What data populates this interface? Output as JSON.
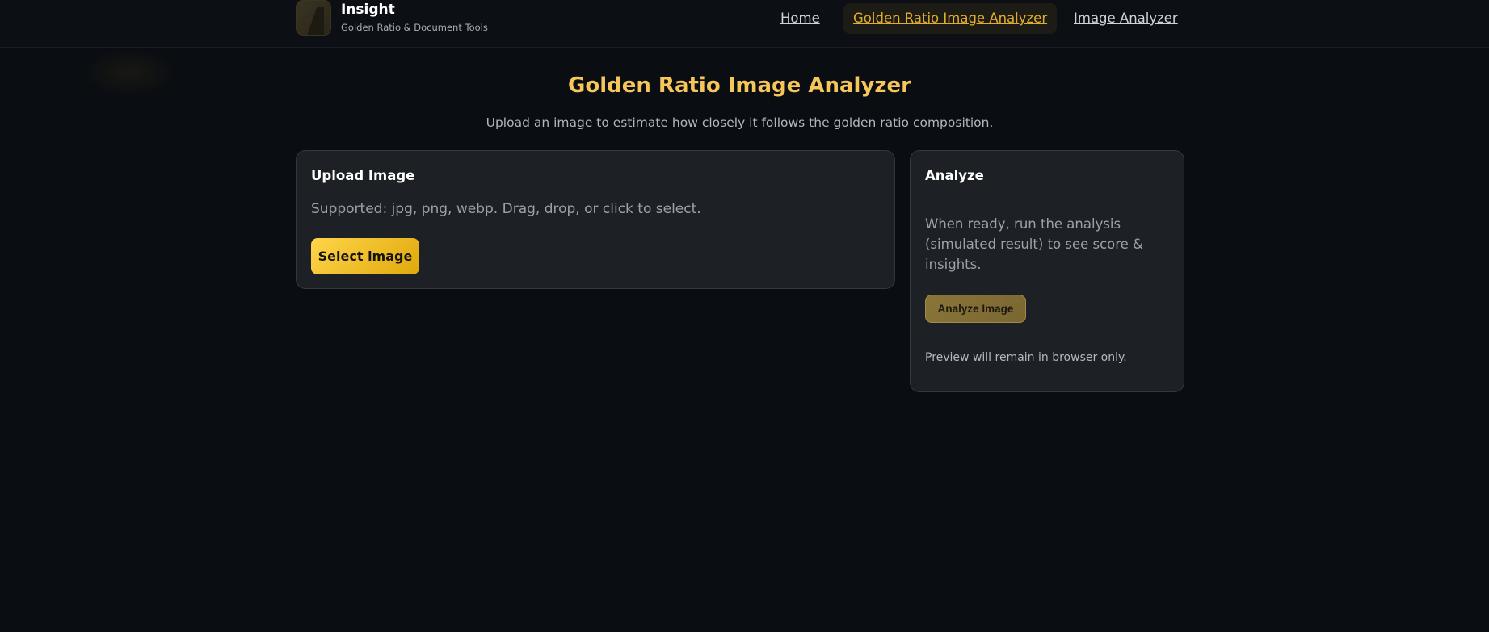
{
  "brand": {
    "title": "Insight",
    "subtitle": "Golden Ratio & Document Tools",
    "logo_icon": "golden-spiral-logo"
  },
  "nav": {
    "items": [
      {
        "label": "Home",
        "active": false
      },
      {
        "label": "Golden Ratio Image Analyzer",
        "active": true
      },
      {
        "label": "Image Analyzer",
        "active": false
      }
    ]
  },
  "page": {
    "title": "Golden Ratio Image Analyzer",
    "description": "Upload an image to estimate how closely it follows the golden ratio composition."
  },
  "upload_card": {
    "title": "Upload Image",
    "description": "Supported: jpg, png, webp. Drag, drop, or click to select.",
    "button_label": "Select image"
  },
  "analyze_card": {
    "title": "Analyze",
    "description": "When ready, run the analysis (simulated result) to see score & insights.",
    "button_label": "Analyze Image",
    "note": "Preview will remain in browser only."
  },
  "colors": {
    "accent": "#f6c65b",
    "button_gold": "#ffd54a",
    "background": "#0a0d11",
    "card": "#1d2025"
  }
}
